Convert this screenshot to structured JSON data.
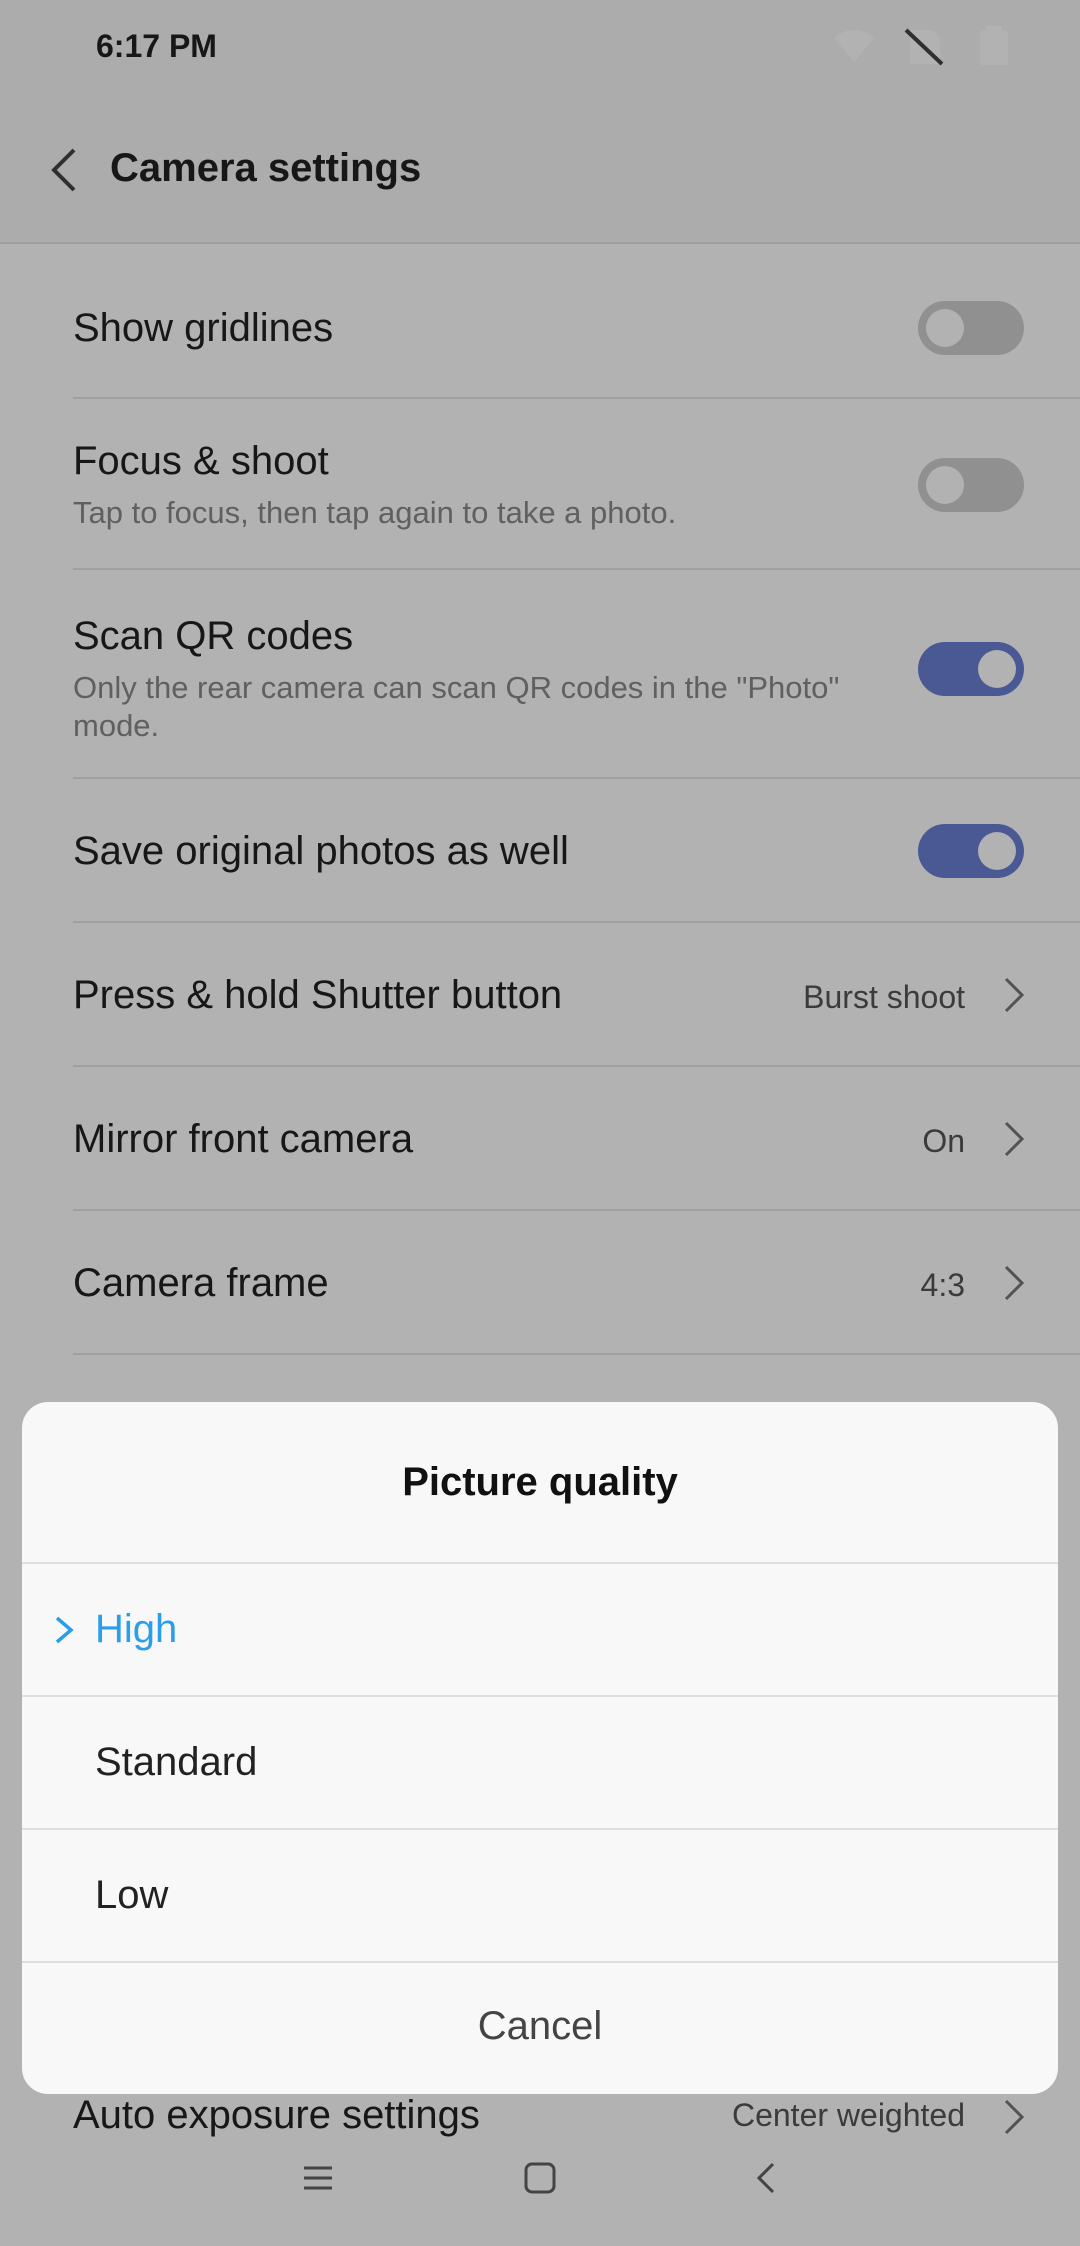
{
  "status_bar": {
    "time": "6:17 PM"
  },
  "app_bar": {
    "title": "Camera settings"
  },
  "settings": [
    {
      "title": "Show gridlines",
      "subtitle": "",
      "control": "toggle",
      "state": false
    },
    {
      "title": "Focus & shoot",
      "subtitle": "Tap to focus, then tap again to take a photo.",
      "control": "toggle",
      "state": false
    },
    {
      "title": "Scan QR codes",
      "subtitle": "Only the rear camera can scan QR codes in the \"Photo\" mode.",
      "control": "toggle",
      "state": true
    },
    {
      "title": "Save original photos as well",
      "subtitle": "",
      "control": "toggle",
      "state": true
    },
    {
      "title": "Press & hold Shutter button",
      "value": "Burst shoot",
      "control": "chevron"
    },
    {
      "title": "Mirror front camera",
      "value": "On",
      "control": "chevron"
    },
    {
      "title": "Camera frame",
      "value": "4:3",
      "control": "chevron"
    }
  ],
  "partial_row": {
    "title": "Auto exposure settings",
    "value": "Center weighted"
  },
  "dialog": {
    "title": "Picture quality",
    "options": [
      "High",
      "Standard",
      "Low"
    ],
    "selected": "High",
    "cancel_label": "Cancel"
  },
  "colors": {
    "accent_blue": "#2a9ee8",
    "toggle_on": "#6a7fd3",
    "toggle_off": "#cfcfcf"
  }
}
